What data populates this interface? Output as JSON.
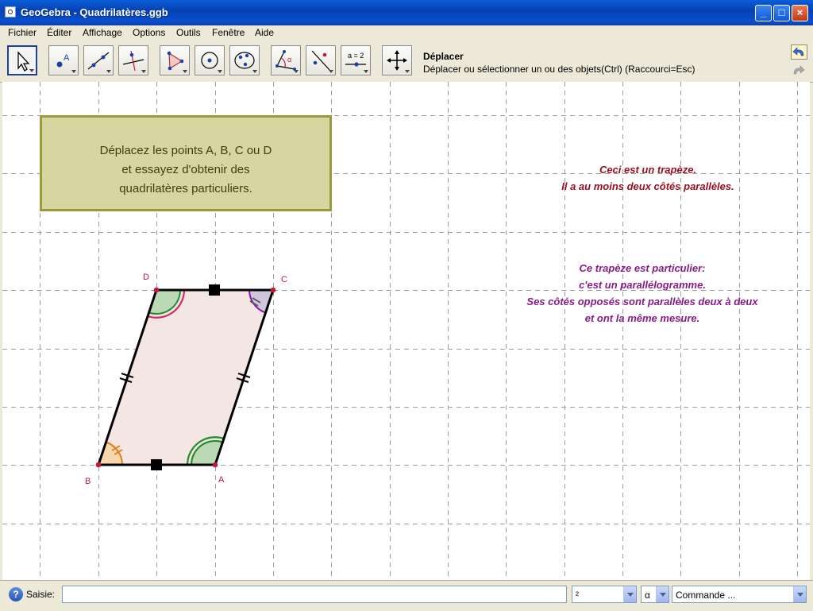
{
  "window": {
    "title": "GeoGebra - Quadrilatères.ggb",
    "controls": {
      "minimize": "_",
      "maximize": "□",
      "close": "×"
    }
  },
  "menu": {
    "items": [
      {
        "label": "Fichier"
      },
      {
        "label": "Éditer"
      },
      {
        "label": "Affichage"
      },
      {
        "label": "Options"
      },
      {
        "label": "Outils"
      },
      {
        "label": "Fenêtre"
      },
      {
        "label": "Aide"
      }
    ]
  },
  "toolbar": {
    "tools": [
      {
        "icon": "move-pointer-icon",
        "selected": true
      },
      {
        "icon": "new-point-icon"
      },
      {
        "icon": "line-through-two-points-icon"
      },
      {
        "icon": "perpendicular-line-icon"
      },
      {
        "icon": "polygon-icon"
      },
      {
        "icon": "circle-with-center-icon"
      },
      {
        "icon": "conic-through-five-points-icon"
      },
      {
        "icon": "angle-icon"
      },
      {
        "icon": "reflect-about-line-icon"
      },
      {
        "icon": "slider-icon",
        "text": "a = 2"
      },
      {
        "icon": "move-graphics-view-icon"
      }
    ],
    "active_tool_title": "Déplacer",
    "active_tool_help": "Déplacer ou sélectionner un ou des objets(Ctrl) (Raccourci=Esc)"
  },
  "canvas": {
    "info_box": {
      "lines": [
        "Déplacez les points A, B, C ou D",
        "et essayez d'obtenir des",
        "quadrilatères particuliers."
      ]
    },
    "trapezoid_text": {
      "lines": [
        "Ceci est un trapèze.",
        "Il a au moins deux côtés parallèles."
      ],
      "color": "#9c1020"
    },
    "parallelogram_text": {
      "lines": [
        "Ce trapèze est particulier:",
        "c'est un parallélogramme.",
        "Ses côtés opposés sont parallèles deux à deux",
        "et ont la même mesure."
      ],
      "color": "#8a1a8a"
    },
    "points": {
      "A": "A",
      "B": "B",
      "C": "C",
      "D": "D"
    },
    "colors": {
      "fill": "#f4e6e2",
      "edge": "#000000",
      "point": "#c2163c",
      "grid": "#9e9e9e"
    }
  },
  "input_bar": {
    "label": "Saisie:",
    "value": "",
    "symbol_combo": "²",
    "greek_combo": "α",
    "command_combo": "Commande ..."
  }
}
